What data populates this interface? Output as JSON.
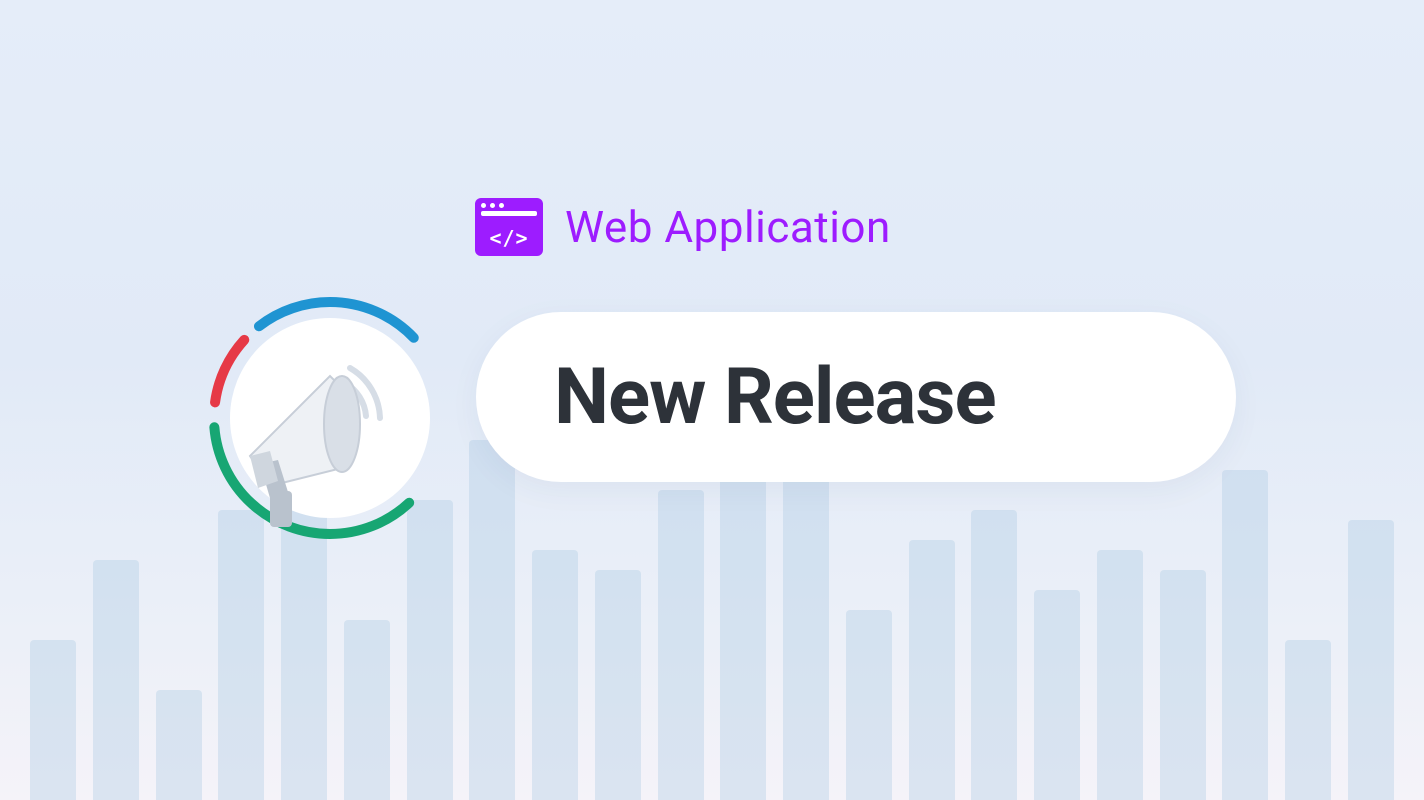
{
  "category": {
    "label": "Web Application",
    "icon": "code-window-icon"
  },
  "headline": "New Release",
  "colors": {
    "accent_purple": "#9d1cff",
    "headline_text": "#2d3239",
    "ring_blue": "#1f94d2",
    "ring_green": "#17a673",
    "ring_red": "#e63946",
    "ring_orange": "#f28c28"
  },
  "background_bars_heights": [
    160,
    240,
    110,
    290,
    340,
    180,
    300,
    360,
    250,
    230,
    310,
    340,
    350,
    190,
    260,
    290,
    210,
    250,
    230,
    330,
    160,
    280
  ]
}
